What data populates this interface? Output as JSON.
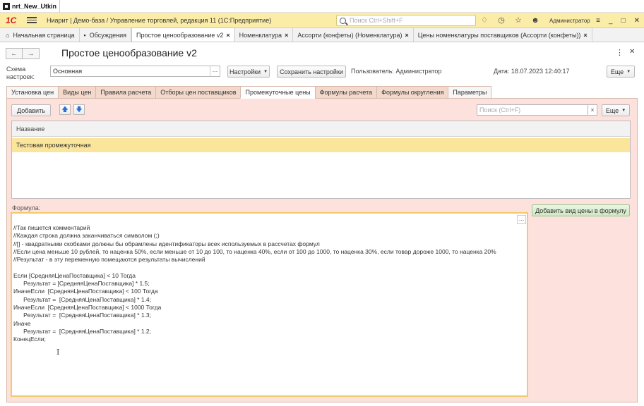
{
  "os_window": {
    "title": "nrt_New_Utkin"
  },
  "header": {
    "logo": "1С",
    "title": "Ниарит | Демо-база / Управление торговлей, редакция 11  (1С:Предприятие)",
    "search_placeholder": "Поиск Ctrl+Shift+F",
    "user": "Администратор",
    "icons": [
      "bell-icon",
      "history-icon",
      "star-icon",
      "user-icon",
      "settings-lines-icon",
      "minimize-icon",
      "restore-icon",
      "close-icon"
    ]
  },
  "window_tabs": [
    {
      "label": "Начальная страница",
      "icon": "home-icon",
      "closable": false
    },
    {
      "label": "Обсуждения",
      "icon": "chat-icon",
      "closable": false
    },
    {
      "label": "Простое ценообразование v2",
      "closable": true,
      "active": true
    },
    {
      "label": "Номенклатура",
      "closable": true
    },
    {
      "label": "Ассорти (конфеты) (Номенклатура)",
      "closable": true
    },
    {
      "label": "Цены номенклатуры поставщиков (Ассорти (конфеты))",
      "closable": true
    }
  ],
  "form": {
    "title": "Простое ценообразование v2",
    "settings_label": "Схема настроек:",
    "settings_value": "Основная",
    "settings_button": "Настройки",
    "save_settings_button": "Сохранить настройки",
    "user_text": "Пользователь: Администратор",
    "date_text": "Дата:  18.07.2023 12:40:17",
    "more_button": "Еще"
  },
  "page_tabs": [
    "Установка цен",
    "Виды цен",
    "Правила расчета",
    "Отборы цен поставщиков",
    "Промежуточные цены",
    "Формулы расчета",
    "Формулы округления",
    "Параметры"
  ],
  "active_page_tab": "Промежуточные цены",
  "intermediate": {
    "add_button": "Добавить",
    "search_placeholder": "Поиск (Ctrl+F)",
    "more_button": "Еще",
    "grid_header": "Название",
    "rows": [
      "Тестовая промежуточная"
    ],
    "formula_label": "Формула:",
    "add_price_button": "Добавить вид цены в формулу",
    "formula_lines": [
      "//Так пишется комментарий",
      "//Каждая строка должна заканчиваться символом (;)",
      "//[] - квадратными скобками должны бы обрамлены идентификаторы всех используемых в рассчетах формул",
      "//Если цена меньше 10 рублей, то наценка 50%, если меньше от 10 до 100, то наценка 40%, если от 100 до 1000, то наценка 30%, если товар дороже 1000, то наценка 20%",
      "//Результат - в эту переменную помещаются результаты вычислений",
      "",
      "Если [СредняяЦенаПоставщика] < 10 Тогда",
      "      Результат = [СредняяЦенаПоставщика] * 1.5;",
      "ИначеЕсли  [СредняяЦенаПоставщика] < 100 Тогда",
      "      Результат =  [СредняяЦенаПоставщика] * 1.4;",
      "ИначеЕсли  [СредняяЦенаПоставщика] < 1000 Тогда",
      "      Результат =  [СредняяЦенаПоставщика] * 1.3;",
      "Иначе",
      "      Результат =  [СредняяЦенаПоставщика] * 1.2;",
      "КонецЕсли;"
    ]
  }
}
